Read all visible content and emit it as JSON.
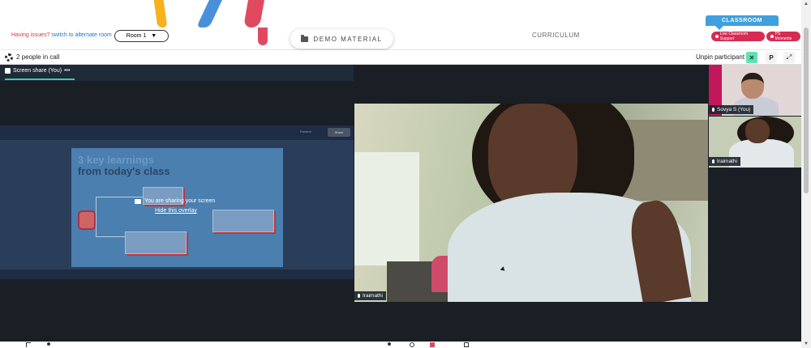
{
  "header": {
    "issues_text": "Having issues?",
    "issues_link": "switch to alternate room",
    "room_select": "Room 1",
    "demo_material": "DEMO MATERIAL",
    "curriculum": "CURRICULUM",
    "classroom_tab": "CLASSROOM",
    "live_support": "Live Classroom Support",
    "ps_moments": "PS Moments"
  },
  "callbar": {
    "people_count": "2 people in call",
    "unpin_label": "Unpin participant",
    "p_label": "P"
  },
  "screen_share": {
    "tab_label": "Screen share (You)",
    "menu": "•••",
    "slide_title_line1": "3 key learnings",
    "slide_title_line2": "from today's class",
    "overlay_text": "You are sharing your screen",
    "overlay_link": "Hide this overlay",
    "share_label": "Share",
    "present_label": "Present"
  },
  "videos": {
    "main_name": "Iraimathi",
    "thumb1_name": "Sovya S (You)",
    "thumb2_name": "Iraimathi"
  },
  "colors": {
    "accent_red": "#d62c52",
    "classroom_blue": "#3fa0e0",
    "call_bg": "#1a1e25",
    "pin_green": "#5fe3b0"
  }
}
